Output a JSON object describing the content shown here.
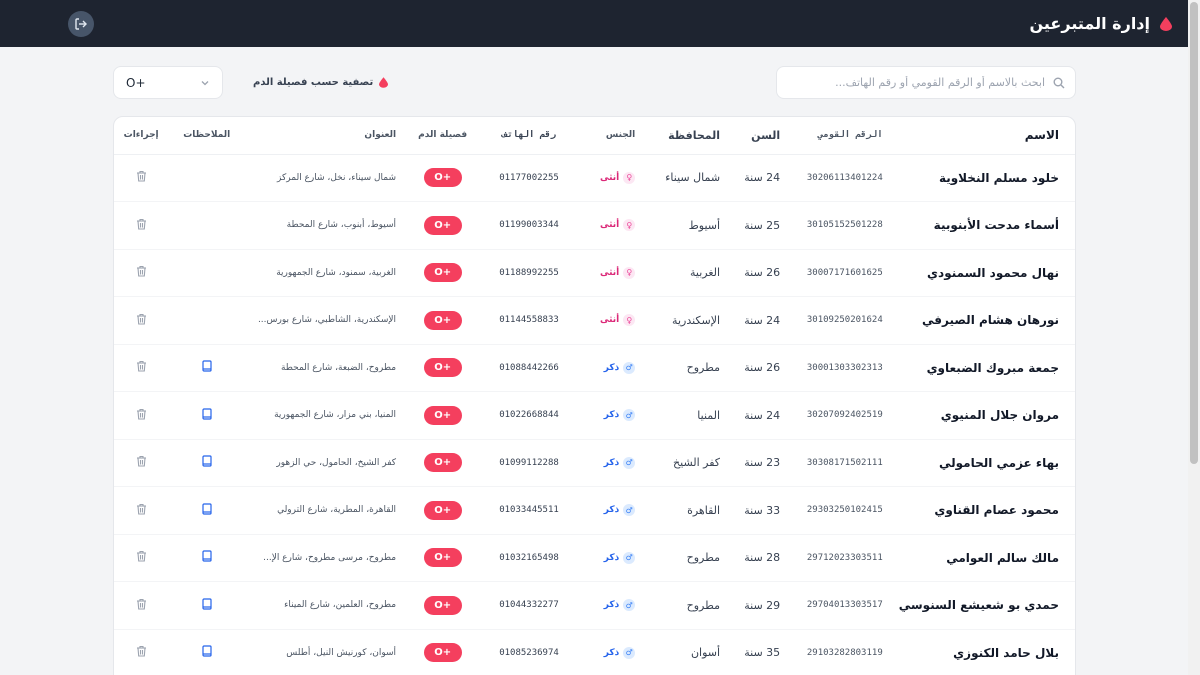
{
  "header": {
    "title": "إدارة المتبرعين"
  },
  "search": {
    "placeholder": "ابحث بالاسم أو الرقم القومي أو رقم الهاتف..."
  },
  "filter": {
    "label": "تصفية حسب فصيلة الدم",
    "selected": "O+"
  },
  "table": {
    "columns": {
      "name": "الاسم",
      "national_id": "الرقم القومي",
      "age": "السن",
      "governorate": "المحافظة",
      "gender": "الجنس",
      "phone": "رقم الهاتف",
      "blood": "فصيلة الدم",
      "address": "العنوان",
      "notes": "الملاحظات",
      "actions": "إجراءات"
    },
    "rows": [
      {
        "name": "خلود مسلم النخلاوية",
        "national_id": "30206113401224",
        "age": "24 سنة",
        "governorate": "شمال سيناء",
        "gender": "أنثى",
        "gender_type": "f",
        "phone": "01177002255",
        "blood": "O+",
        "address": "شمال سيناء، نخل، شارع المركز",
        "has_notes": false
      },
      {
        "name": "أسماء مدحت الأبنوبية",
        "national_id": "30105152501228",
        "age": "25 سنة",
        "governorate": "أسيوط",
        "gender": "أنثى",
        "gender_type": "f",
        "phone": "01199003344",
        "blood": "O+",
        "address": "أسيوط، أبنوب، شارع المحطة",
        "has_notes": false
      },
      {
        "name": "نهال محمود السمنودي",
        "national_id": "30007171601625",
        "age": "26 سنة",
        "governorate": "الغربية",
        "gender": "أنثى",
        "gender_type": "f",
        "phone": "01188992255",
        "blood": "O+",
        "address": "الغربية، سمنود، شارع الجمهورية",
        "has_notes": false
      },
      {
        "name": "نورهان هشام الصيرفي",
        "national_id": "30109250201624",
        "age": "24 سنة",
        "governorate": "الإسكندرية",
        "gender": "أنثى",
        "gender_type": "f",
        "phone": "01144558833",
        "blood": "O+",
        "address": "الإسكندرية، الشاطبي، شارع بورس...",
        "has_notes": false
      },
      {
        "name": "جمعة مبروك الضبعاوي",
        "national_id": "30001303302313",
        "age": "26 سنة",
        "governorate": "مطروح",
        "gender": "ذكر",
        "gender_type": "m",
        "phone": "01088442266",
        "blood": "O+",
        "address": "مطروح، الضبعة، شارع المحطة",
        "has_notes": true
      },
      {
        "name": "مروان جلال المنيوي",
        "national_id": "30207092402519",
        "age": "24 سنة",
        "governorate": "المنيا",
        "gender": "ذكر",
        "gender_type": "m",
        "phone": "01022668844",
        "blood": "O+",
        "address": "المنيا، بني مزار، شارع الجمهورية",
        "has_notes": true
      },
      {
        "name": "بهاء عزمي الحامولي",
        "national_id": "30308171502111",
        "age": "23 سنة",
        "governorate": "كفر الشيخ",
        "gender": "ذكر",
        "gender_type": "m",
        "phone": "01099112288",
        "blood": "O+",
        "address": "كفر الشيخ، الحامول، حي الزهور",
        "has_notes": true
      },
      {
        "name": "محمود عصام القناوي",
        "national_id": "29303250102415",
        "age": "33 سنة",
        "governorate": "القاهرة",
        "gender": "ذكر",
        "gender_type": "m",
        "phone": "01033445511",
        "blood": "O+",
        "address": "القاهرة، المطرية، شارع الترولي",
        "has_notes": true
      },
      {
        "name": "مالك سالم العوامي",
        "national_id": "29712023303511",
        "age": "28 سنة",
        "governorate": "مطروح",
        "gender": "ذكر",
        "gender_type": "m",
        "phone": "01032165498",
        "blood": "O+",
        "address": "مطروح، مرسى مطروح، شارع الإ...",
        "has_notes": true
      },
      {
        "name": "حمدي بو شعيشع السنوسي",
        "national_id": "29704013303517",
        "age": "29 سنة",
        "governorate": "مطروح",
        "gender": "ذكر",
        "gender_type": "m",
        "phone": "01044332277",
        "blood": "O+",
        "address": "مطروح، العلمين، شارع الميناء",
        "has_notes": true
      },
      {
        "name": "بلال حامد الكنوزي",
        "national_id": "29103282803119",
        "age": "35 سنة",
        "governorate": "أسوان",
        "gender": "ذكر",
        "gender_type": "m",
        "phone": "01085236974",
        "blood": "O+",
        "address": "أسوان، كورنيش النيل، أطلس",
        "has_notes": true
      }
    ]
  },
  "colors": {
    "topbar": "#1e2430",
    "blood_badge": "#f43f5e",
    "female": "#db2777",
    "male": "#2563eb",
    "accent_drop": "#f43f5e"
  }
}
